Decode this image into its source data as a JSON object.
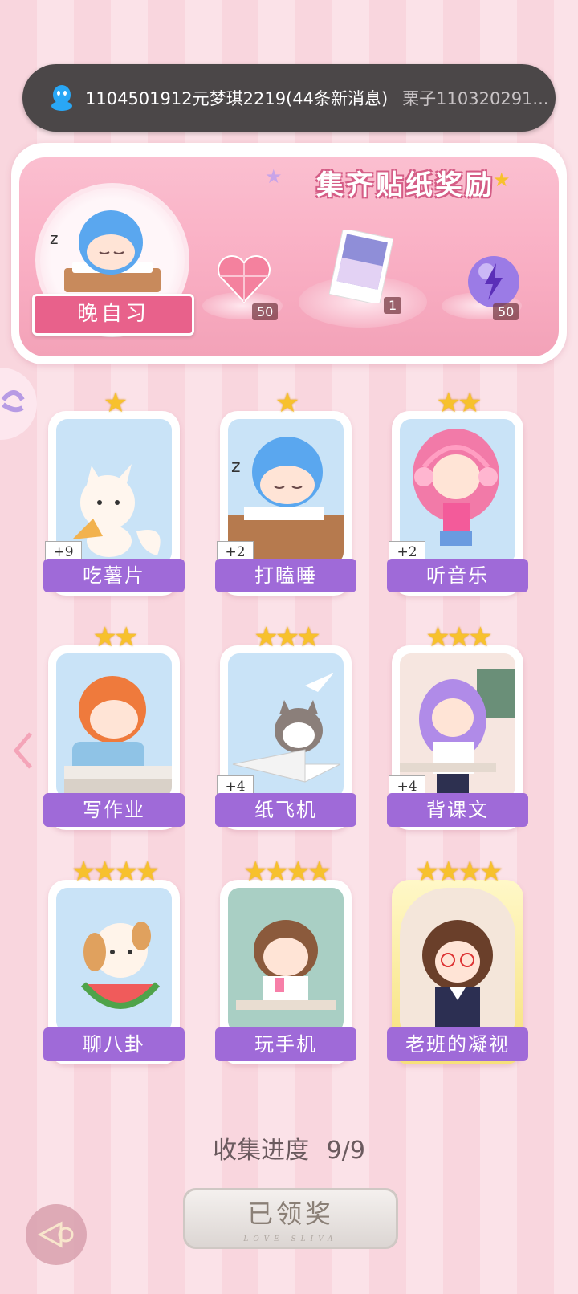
{
  "notification": {
    "main_text": "1104501912元梦琪2219(44条新消息)",
    "sub_text": "栗子110320291..."
  },
  "banner": {
    "title": "集齐贴纸奖励",
    "badge_label": "晚自习",
    "rewards": [
      {
        "name": "heart-gem",
        "count": "50"
      },
      {
        "name": "sticker-card",
        "count": "1"
      },
      {
        "name": "lightning-orb",
        "count": "50"
      }
    ]
  },
  "cards": [
    {
      "label": "吃薯片",
      "stars": 1,
      "plus": "+9"
    },
    {
      "label": "打瞌睡",
      "stars": 1,
      "plus": "+2"
    },
    {
      "label": "听音乐",
      "stars": 2,
      "plus": "+2"
    },
    {
      "label": "写作业",
      "stars": 2,
      "plus": ""
    },
    {
      "label": "纸飞机",
      "stars": 3,
      "plus": "+4"
    },
    {
      "label": "背课文",
      "stars": 3,
      "plus": "+4"
    },
    {
      "label": "聊八卦",
      "stars": 4,
      "plus": ""
    },
    {
      "label": "玩手机",
      "stars": 4,
      "plus": ""
    },
    {
      "label": "老班的凝视",
      "stars": 4,
      "plus": ""
    }
  ],
  "progress": {
    "label": "收集进度",
    "value": "9/9"
  },
  "claim_button": {
    "label": "已领奖",
    "sub": "LOVE SLIVA"
  },
  "colors": {
    "accent_purple": "#9f6ad8",
    "pink": "#f9aec3",
    "star": "#f7c12d"
  }
}
